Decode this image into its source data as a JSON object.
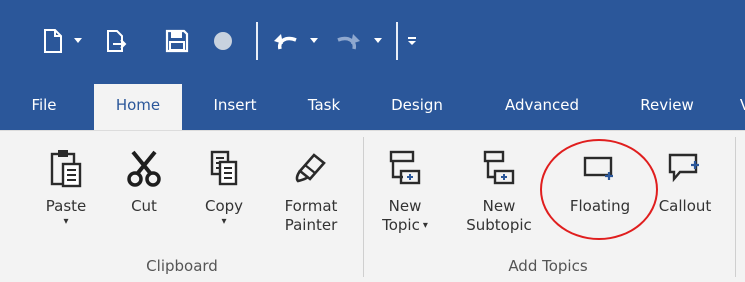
{
  "quick_access": {
    "icons": [
      "new-document-icon",
      "open-file-icon",
      "save-icon",
      "circle-icon",
      "undo-icon",
      "redo-icon",
      "customize-icon"
    ],
    "colors": {
      "bar": "#2b579a",
      "icon": "#ffffff",
      "disabled_icon": "#8fa8cf"
    }
  },
  "tabs": [
    {
      "label": "File",
      "active": false
    },
    {
      "label": "Home",
      "active": true
    },
    {
      "label": "Insert",
      "active": false
    },
    {
      "label": "Task",
      "active": false
    },
    {
      "label": "Design",
      "active": false
    },
    {
      "label": "Advanced",
      "active": false
    },
    {
      "label": "Review",
      "active": false
    },
    {
      "label": "V",
      "active": false
    }
  ],
  "clipboard": {
    "group_label": "Clipboard",
    "paste": {
      "label": "Paste",
      "dropdown": "▾",
      "icon": "paste-icon"
    },
    "cut": {
      "label": "Cut",
      "icon": "scissors-icon"
    },
    "copy": {
      "label": "Copy",
      "dropdown": "▾",
      "icon": "copy-icon"
    },
    "format_painter": {
      "line1": "Format",
      "line2": "Painter",
      "icon": "paintbrush-icon"
    }
  },
  "add_topics": {
    "group_label": "Add Topics",
    "new_topic": {
      "line1": "New",
      "line2": "Topic",
      "dropdown": "▾",
      "icon": "new-topic-icon"
    },
    "new_subtopic": {
      "line1": "New",
      "line2": "Subtopic",
      "icon": "new-subtopic-icon"
    },
    "floating": {
      "label": "Floating",
      "icon": "floating-topic-icon",
      "highlighted": true
    },
    "callout": {
      "label": "Callout",
      "icon": "callout-icon"
    }
  },
  "colors": {
    "accent": "#2b579a",
    "highlight": "#e01e1e",
    "ribbon": "#f3f3f3"
  }
}
